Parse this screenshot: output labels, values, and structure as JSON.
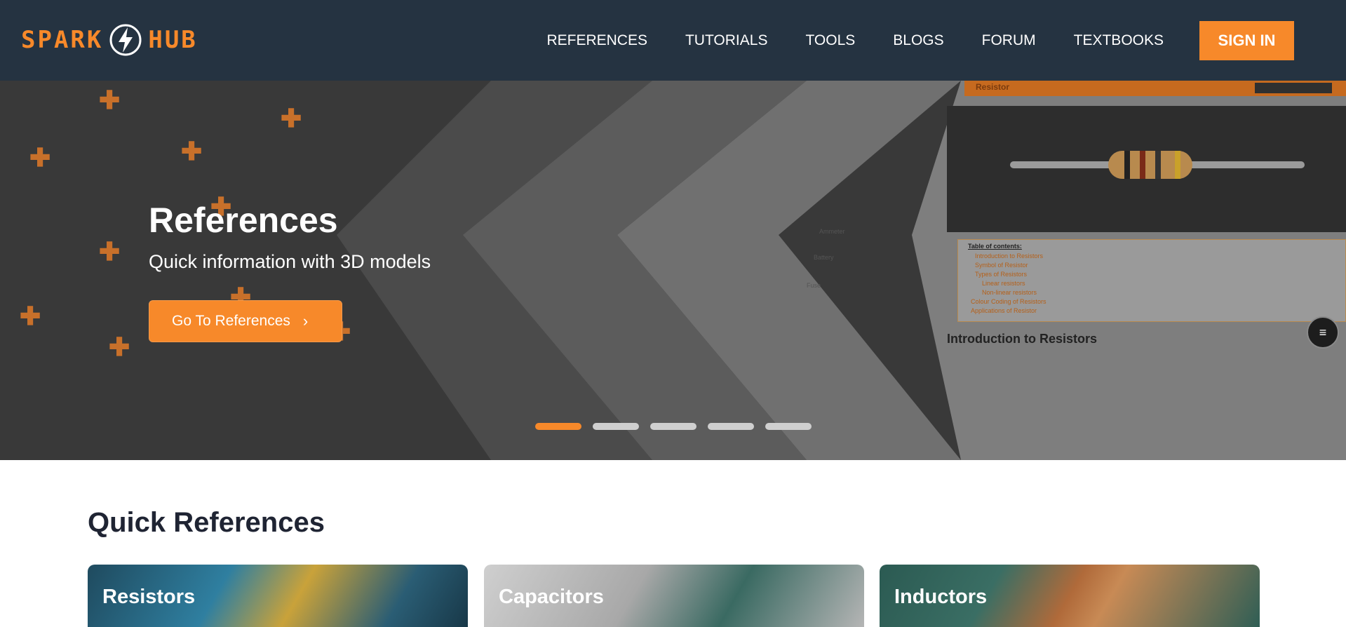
{
  "header": {
    "logo_left": "SPARK",
    "logo_right": "HUB",
    "nav": [
      "REFERENCES",
      "TUTORIALS",
      "TOOLS",
      "BLOGS",
      "FORUM",
      "TEXTBOOKS"
    ],
    "signin_label": "SIGN IN"
  },
  "hero": {
    "title": "References",
    "subtitle": "Quick information with 3D models",
    "button_label": "Go To References",
    "slides_total": 5,
    "active_slide": 1
  },
  "preview": {
    "bar_title": "Resistor",
    "heading": "Introduction to Resistors",
    "toc_title": "Table of contents:",
    "toc_items": [
      "Introduction to Resistors",
      "Symbol of Resistor",
      "Types of Resistors",
      "Linear resistors",
      "Non-linear resistors",
      "Colour Coding of Resistors",
      "Applications of Resistor"
    ],
    "side_labels": [
      "Ammeter",
      "Battery",
      "Fuse"
    ]
  },
  "quick_refs": {
    "title": "Quick References",
    "cards": [
      "Resistors",
      "Capacitors",
      "Inductors"
    ]
  },
  "colors": {
    "accent": "#f7892a",
    "header_bg": "#253341"
  }
}
